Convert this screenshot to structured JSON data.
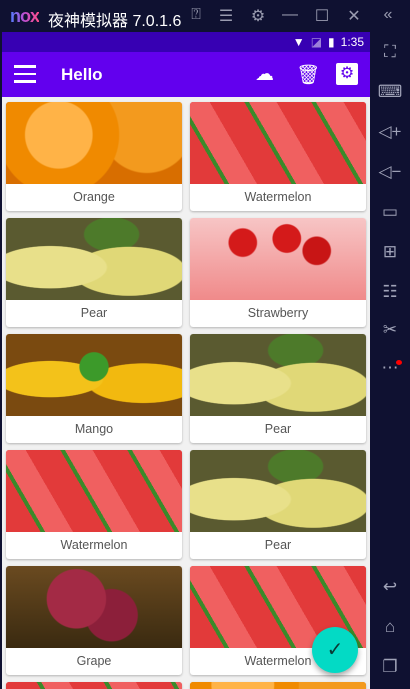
{
  "window": {
    "logo": "nox",
    "title": "夜神模拟器 7.0.1.6",
    "icons": [
      "help-icon",
      "menu-icon",
      "gear-icon",
      "minimize-icon",
      "maximize-icon",
      "close-icon",
      "collapse-icon"
    ]
  },
  "sidebar": {
    "icons": [
      "fullscreen-icon",
      "keyboard-icon",
      "volume-up-icon",
      "volume-down-icon",
      "screen-icon",
      "apk-install-icon",
      "multi-instance-icon",
      "scissors-icon",
      "more-icon",
      "back-icon",
      "home-icon",
      "recents-icon"
    ]
  },
  "status": {
    "time": "1:35"
  },
  "appbar": {
    "title": "Hello",
    "actions": [
      "upload-icon",
      "delete-icon",
      "settings-icon"
    ]
  },
  "colors": {
    "primary": "#6200ee",
    "primary_dark": "#3700b3",
    "accent": "#03dac5"
  },
  "grid": [
    {
      "label": "Orange",
      "image": "orange"
    },
    {
      "label": "Watermelon",
      "image": "watermelon"
    },
    {
      "label": "Pear",
      "image": "pear"
    },
    {
      "label": "Strawberry",
      "image": "strawberry"
    },
    {
      "label": "Mango",
      "image": "mango"
    },
    {
      "label": "Pear",
      "image": "pear"
    },
    {
      "label": "Watermelon",
      "image": "watermelon"
    },
    {
      "label": "Pear",
      "image": "pear"
    },
    {
      "label": "Grape",
      "image": "grape"
    },
    {
      "label": "Watermelon",
      "image": "watermelon"
    }
  ]
}
